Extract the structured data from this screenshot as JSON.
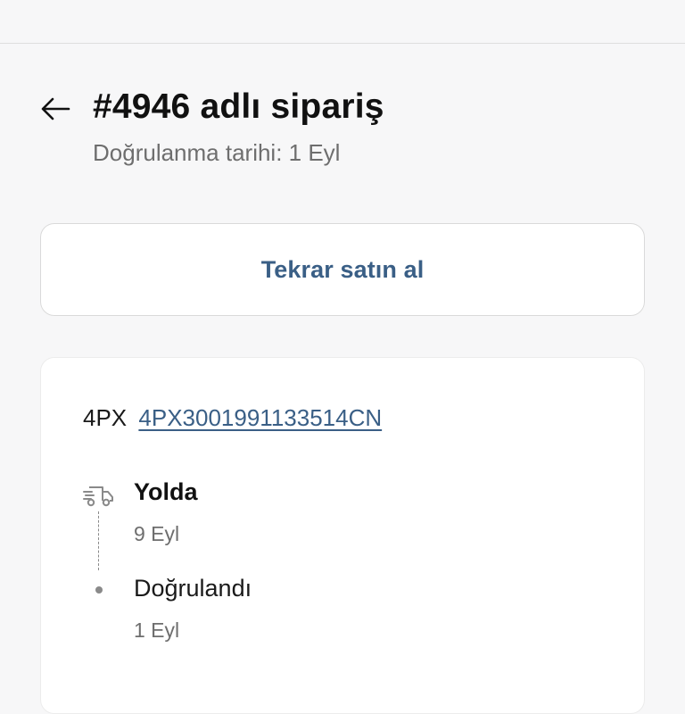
{
  "header": {
    "title": "#4946 adlı sipariş",
    "subtitle": "Doğrulanma tarihi: 1 Eyl",
    "back_icon": "arrow-left-icon"
  },
  "actions": {
    "buy_again_label": "Tekrar satın al"
  },
  "shipment": {
    "carrier": "4PX",
    "tracking_number": "4PX3001991133514CN",
    "events": [
      {
        "status": "Yolda",
        "date": "9 Eyl",
        "icon": "delivery-truck-icon"
      },
      {
        "status": "Doğrulandı",
        "date": "1 Eyl",
        "icon": "timeline-dot-icon"
      }
    ]
  },
  "colors": {
    "background": "#f7f7f8",
    "accent": "#3a5f86",
    "muted_text": "#6e6e6e"
  }
}
